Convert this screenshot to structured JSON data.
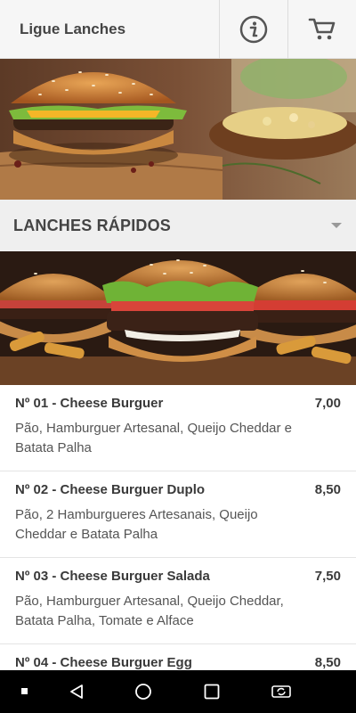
{
  "header": {
    "title": "Ligue Lanches",
    "info_icon": "info-icon",
    "cart_icon": "cart-icon"
  },
  "section": {
    "title": "LANCHES RÁPIDOS"
  },
  "items": [
    {
      "name": "Nº 01 - Cheese Burguer",
      "price": "7,00",
      "description": "Pão, Hamburguer Artesanal, Queijo Cheddar e Batata Palha"
    },
    {
      "name": "Nº 02 - Cheese Burguer Duplo",
      "price": "8,50",
      "description": "Pão, 2 Hamburgueres Artesanais, Queijo Cheddar e Batata Palha"
    },
    {
      "name": "Nº 03 - Cheese Burguer Salada",
      "price": "7,50",
      "description": "Pão, Hamburguer Artesanal, Queijo Cheddar, Batata Palha, Tomate e Alface"
    },
    {
      "name": "Nº 04 - Cheese Burguer Egg",
      "price": "8,50",
      "description": ""
    }
  ],
  "navbar": {
    "icons": [
      "dot-icon",
      "back-icon",
      "home-icon",
      "recents-icon",
      "rotate-icon"
    ]
  },
  "colors": {
    "topbar_bg": "#f6f6f6",
    "section_bg": "#efefef",
    "text_dark": "#3a3a3a",
    "navbar_bg": "#000000"
  }
}
